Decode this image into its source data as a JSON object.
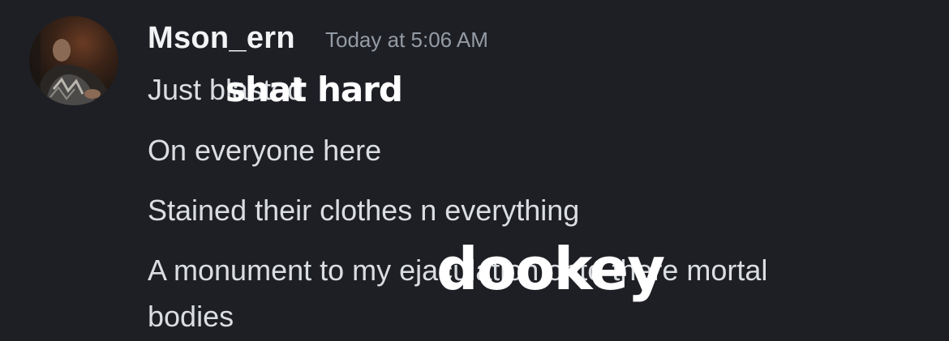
{
  "message": {
    "author": "Mson_ern",
    "timestamp": "Today at 5:06 AM",
    "avatar_icon": "user-avatar",
    "lines": [
      "Just blasted",
      "On everyone here",
      "Stained their clothes n everything",
      "A monument to my ejaculation onto there mortal",
      "bodies"
    ]
  },
  "overlays": {
    "caption_1": "shat hard",
    "caption_2": "dookey",
    "color": "#ffffff"
  },
  "colors": {
    "background": "#1e1f25",
    "username": "#f2f3f5",
    "timestamp": "#949ba4",
    "message_text": "#dbdee1"
  }
}
